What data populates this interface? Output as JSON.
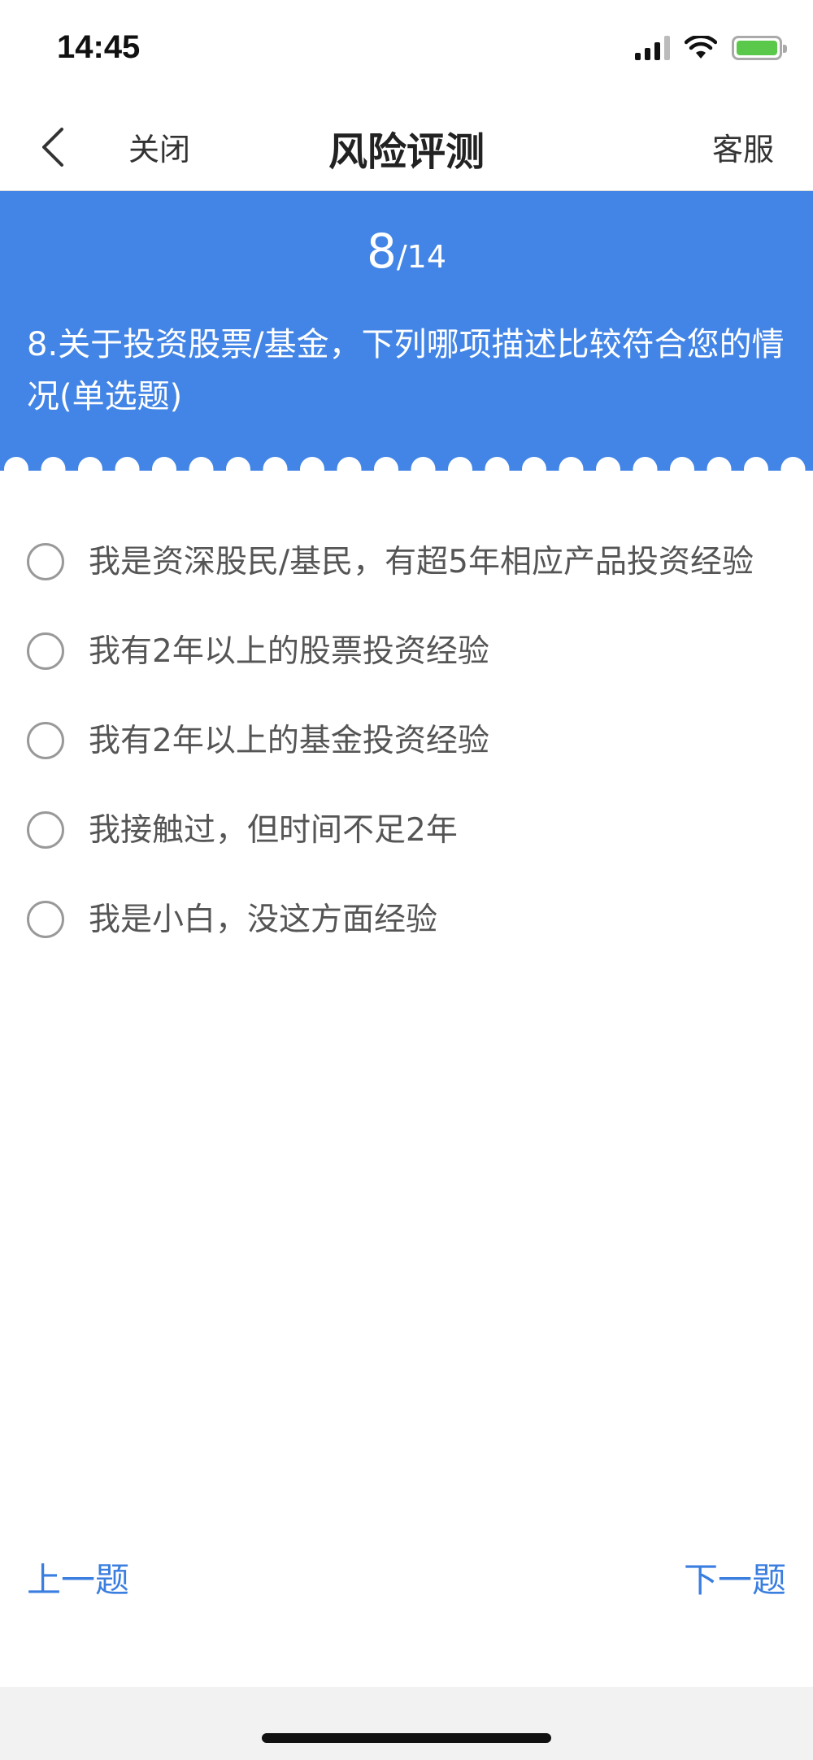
{
  "status_bar": {
    "time": "14:45",
    "icons": [
      "signal-icon",
      "wifi-icon",
      "battery-charging-icon"
    ]
  },
  "nav": {
    "back_icon": "chevron-left-icon",
    "close_label": "关闭",
    "title": "风险评测",
    "service_label": "客服"
  },
  "question": {
    "current": "8",
    "total": "/14",
    "text": "8.关于投资股票/基金，下列哪项描述比较符合您的情况(单选题)"
  },
  "options": [
    {
      "label": "我是资深股民/基民，有超5年相应产品投资经验",
      "selected": false
    },
    {
      "label": "我有2年以上的股票投资经验",
      "selected": false
    },
    {
      "label": "我有2年以上的基金投资经验",
      "selected": false
    },
    {
      "label": "我接触过，但时间不足2年",
      "selected": false
    },
    {
      "label": "我是小白，没这方面经验",
      "selected": false
    }
  ],
  "footer": {
    "prev_label": "上一题",
    "next_label": "下一题"
  },
  "colors": {
    "accent": "#4385e6",
    "link": "#3a7ee0",
    "battery": "#5ac84a"
  }
}
